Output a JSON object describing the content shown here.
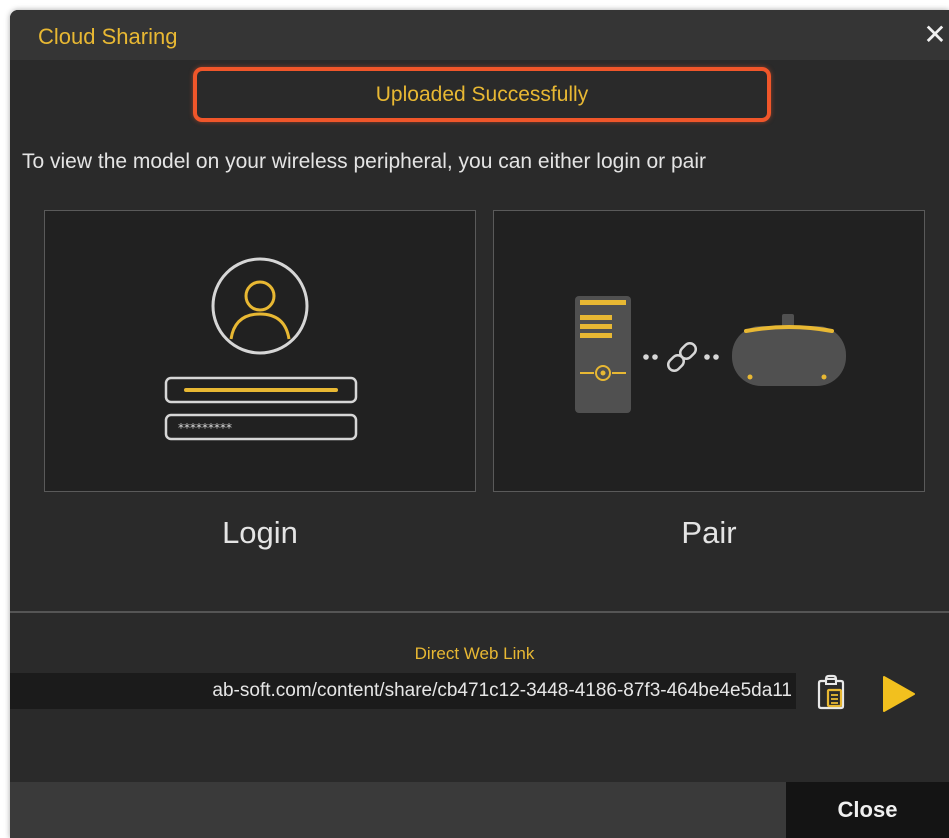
{
  "window": {
    "title": "Cloud Sharing",
    "close_icon": "close-icon"
  },
  "status": {
    "text": "Uploaded Successfully"
  },
  "instruction": "To view the model on your wireless peripheral, you can either login or pair",
  "options": {
    "login": {
      "label": "Login",
      "password_mask": "*********"
    },
    "pair": {
      "label": "Pair"
    }
  },
  "web_link": {
    "heading": "Direct Web Link",
    "value": "ab-soft.com/content/share/cb471c12-3448-4186-87f3-464be4e5da11",
    "copy_icon": "clipboard-icon",
    "open_icon": "play-icon"
  },
  "footer": {
    "close_label": "Close"
  },
  "colors": {
    "accent": "#e8b833",
    "highlight_border": "#f0562a",
    "background": "#2a2a2a"
  }
}
